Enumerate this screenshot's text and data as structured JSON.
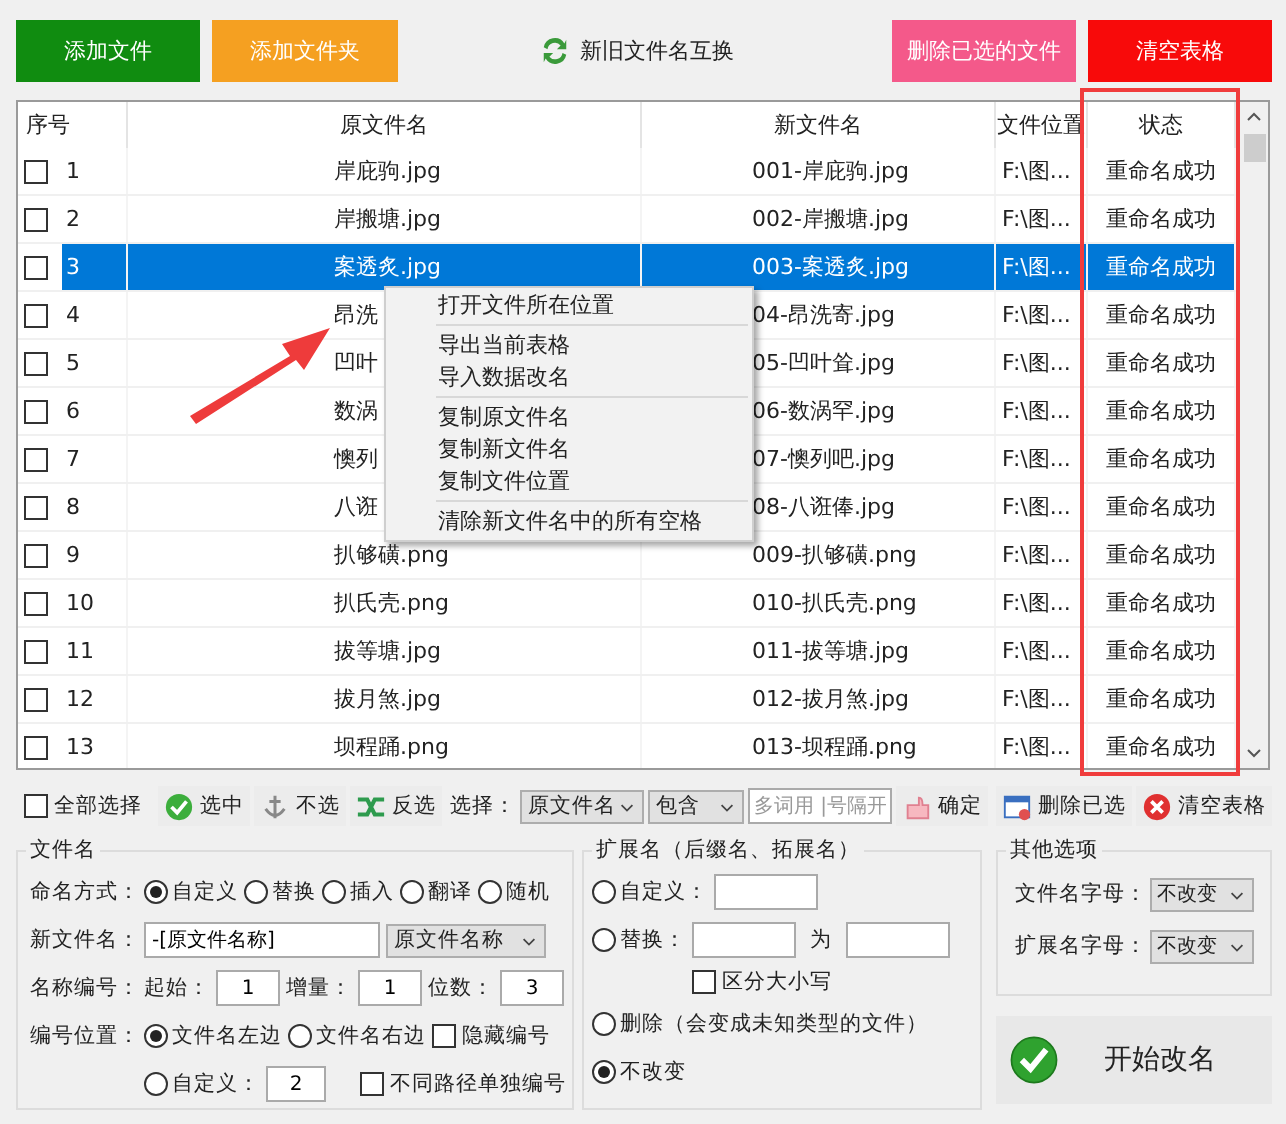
{
  "top_buttons": [
    {
      "kind": "green",
      "label": "添加文件"
    },
    {
      "kind": "orange",
      "label": "添加文件夹"
    },
    {
      "kind": "swap",
      "label": "新旧文件名互换"
    },
    {
      "kind": "pink",
      "label": "删除已选的文件"
    },
    {
      "kind": "red",
      "label": "清空表格"
    }
  ],
  "table": {
    "columns": [
      "序号",
      "原文件名",
      "新文件名",
      "文件位置",
      "状态"
    ],
    "rows": [
      {
        "no": "1",
        "checked": false,
        "selected": false,
        "original": "岸庇驹.jpg",
        "new_name": "001-岸庇驹.jpg",
        "location": "F:\\图...",
        "status": "重命名成功"
      },
      {
        "no": "2",
        "checked": false,
        "selected": false,
        "original": "岸搬塘.jpg",
        "new_name": "002-岸搬塘.jpg",
        "location": "F:\\图...",
        "status": "重命名成功"
      },
      {
        "no": "3",
        "checked": false,
        "selected": true,
        "original": "案透炙.jpg",
        "new_name": "003-案透炙.jpg",
        "location": "F:\\图...",
        "status": "重命名成功"
      },
      {
        "no": "4",
        "checked": false,
        "selected": false,
        "original": "昂洗",
        "new_name": "04-昂洗寄.jpg",
        "location": "F:\\图...",
        "status": "重命名成功"
      },
      {
        "no": "5",
        "checked": false,
        "selected": false,
        "original": "凹叶",
        "new_name": "05-凹叶耸.jpg",
        "location": "F:\\图...",
        "status": "重命名成功"
      },
      {
        "no": "6",
        "checked": false,
        "selected": false,
        "original": "数涡",
        "new_name": "06-数涡罕.jpg",
        "location": "F:\\图...",
        "status": "重命名成功"
      },
      {
        "no": "7",
        "checked": false,
        "selected": false,
        "original": "懊列",
        "new_name": "07-懊列吧.jpg",
        "location": "F:\\图...",
        "status": "重命名成功"
      },
      {
        "no": "8",
        "checked": false,
        "selected": false,
        "original": "八诳",
        "new_name": "08-八诳俸.jpg",
        "location": "F:\\图...",
        "status": "重命名成功"
      },
      {
        "no": "9",
        "checked": false,
        "selected": false,
        "original": "扒够磺.png",
        "new_name": "009-扒够磺.png",
        "location": "F:\\图...",
        "status": "重命名成功"
      },
      {
        "no": "10",
        "checked": false,
        "selected": false,
        "original": "扒氏壳.png",
        "new_name": "010-扒氏壳.png",
        "location": "F:\\图...",
        "status": "重命名成功"
      },
      {
        "no": "11",
        "checked": false,
        "selected": false,
        "original": "拔等塘.jpg",
        "new_name": "011-拔等塘.jpg",
        "location": "F:\\图...",
        "status": "重命名成功"
      },
      {
        "no": "12",
        "checked": false,
        "selected": false,
        "original": "拔月煞.jpg",
        "new_name": "012-拔月煞.jpg",
        "location": "F:\\图...",
        "status": "重命名成功"
      },
      {
        "no": "13",
        "checked": false,
        "selected": false,
        "original": "坝程踊.png",
        "new_name": "013-坝程踊.png",
        "location": "F:\\图...",
        "status": "重命名成功"
      }
    ]
  },
  "context_menu": [
    [
      "打开文件所在位置"
    ],
    [
      "导出当前表格",
      "导入数据改名"
    ],
    [
      "复制原文件名",
      "复制新文件名",
      "复制文件位置"
    ],
    [
      "清除新文件名中的所有空格"
    ]
  ],
  "toolbar": {
    "select_all": {
      "label": "全部选择",
      "checked": false
    },
    "buttons": [
      "选中",
      "不选",
      "反选"
    ],
    "filter_label": "选择：",
    "field_dropdown": "原文件名",
    "match_dropdown": "包含",
    "keyword_placeholder": "多词用 |号隔开",
    "confirm": "确定",
    "right_buttons": [
      "删除已选",
      "清空表格"
    ]
  },
  "filename": {
    "title": "文件名",
    "method_label": "命名方式：",
    "methods": [
      {
        "label": "自定义",
        "selected": true
      },
      {
        "label": "替换",
        "selected": false
      },
      {
        "label": "插入",
        "selected": false
      },
      {
        "label": "翻译",
        "selected": false
      },
      {
        "label": "随机",
        "selected": false
      }
    ],
    "new_name_label": "新文件名：",
    "new_name_value": "-[原文件名称]",
    "new_name_dropdown": "原文件名称",
    "numbering_label": "名称编号：",
    "start_label": "起始：",
    "start": "1",
    "step_label": "增量：",
    "step": "1",
    "digits_label": "位数：",
    "digits": "3",
    "position_label": "编号位置：",
    "left": {
      "label": "文件名左边",
      "selected": true
    },
    "right": {
      "label": "文件名右边",
      "selected": false
    },
    "hide": {
      "label": "隐藏编号",
      "checked": false
    },
    "custom": {
      "label": "自定义：",
      "selected": false,
      "value": "2"
    },
    "per_path": {
      "label": "不同路径单独编号",
      "checked": false
    }
  },
  "extension": {
    "title": "扩展名（后缀名、拓展名）",
    "custom": {
      "label": "自定义：",
      "selected": false
    },
    "replace": {
      "label": "替换：",
      "selected": false,
      "to_label": "为"
    },
    "case": {
      "label": "区分大小写",
      "checked": false
    },
    "delete": {
      "label": "删除（会变成未知类型的文件）",
      "selected": false
    },
    "keep": {
      "label": "不改变",
      "selected": true
    }
  },
  "other": {
    "title": "其他选项",
    "options": [
      {
        "label": "文件名字母：",
        "value": "不改变"
      },
      {
        "label": "扩展名字母：",
        "value": "不改变"
      }
    ]
  },
  "start_button": "开始改名"
}
